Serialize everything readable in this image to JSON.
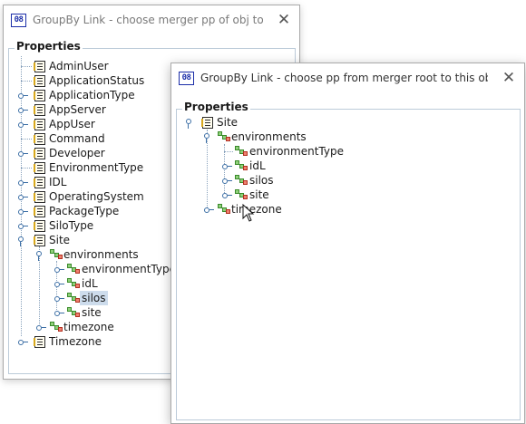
{
  "back_window": {
    "title": "GroupBy Link - choose merger pp of obj to stor...",
    "icon": "app-icon",
    "close_icon": "close-icon",
    "close_label": "✕",
    "panel_title": "Properties",
    "items": [
      {
        "label": "AdminUser"
      },
      {
        "label": "ApplicationStatus"
      },
      {
        "label": "ApplicationType"
      },
      {
        "label": "AppServer"
      },
      {
        "label": "AppUser"
      },
      {
        "label": "Command"
      },
      {
        "label": "Developer"
      },
      {
        "label": "EnvironmentType"
      },
      {
        "label": "IDL"
      },
      {
        "label": "OperatingSystem"
      },
      {
        "label": "PackageType"
      },
      {
        "label": "SiloType"
      },
      {
        "label": "Site"
      },
      {
        "label": "environments"
      },
      {
        "label": "environmentType"
      },
      {
        "label": "idL"
      },
      {
        "label": "silos"
      },
      {
        "label": "site"
      },
      {
        "label": "timezone"
      },
      {
        "label": "Timezone"
      }
    ]
  },
  "front_window": {
    "title": "GroupBy Link - choose pp from merger root to this obj (part...",
    "icon": "app-icon",
    "close_icon": "close-icon",
    "close_label": "✕",
    "panel_title": "Properties",
    "items": [
      {
        "label": "Site"
      },
      {
        "label": "environments"
      },
      {
        "label": "environmentType"
      },
      {
        "label": "idL"
      },
      {
        "label": "silos"
      },
      {
        "label": "site"
      },
      {
        "label": "timezone"
      }
    ]
  },
  "icons": {
    "class_node": "class-node-icon",
    "link_node": "link-node-icon",
    "expand_handle": "tree-handle-icon",
    "mouse_cursor": "mouse-pointer-icon"
  },
  "colors": {
    "selection": "#cddcec",
    "panel_border": "#bccbd9",
    "handle": "#3b6ea5",
    "app_icon": "#1b2ea8"
  }
}
